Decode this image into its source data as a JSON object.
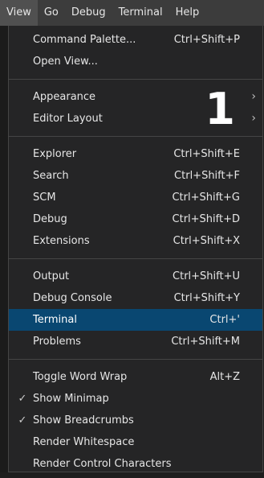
{
  "menubar": {
    "items": [
      {
        "label": "View"
      },
      {
        "label": "Go"
      },
      {
        "label": "Debug"
      },
      {
        "label": "Terminal"
      },
      {
        "label": "Help"
      }
    ]
  },
  "badge": "1",
  "menu": {
    "group1": [
      {
        "label": "Command Palette...",
        "shortcut": "Ctrl+Shift+P"
      },
      {
        "label": "Open View...",
        "shortcut": ""
      }
    ],
    "group2": [
      {
        "label": "Appearance",
        "submenu_icon": "chevron-right-icon"
      },
      {
        "label": "Editor Layout",
        "submenu_icon": "chevron-right-icon"
      }
    ],
    "group3": [
      {
        "label": "Explorer",
        "shortcut": "Ctrl+Shift+E"
      },
      {
        "label": "Search",
        "shortcut": "Ctrl+Shift+F"
      },
      {
        "label": "SCM",
        "shortcut": "Ctrl+Shift+G"
      },
      {
        "label": "Debug",
        "shortcut": "Ctrl+Shift+D"
      },
      {
        "label": "Extensions",
        "shortcut": "Ctrl+Shift+X"
      }
    ],
    "group4": [
      {
        "label": "Output",
        "shortcut": "Ctrl+Shift+U"
      },
      {
        "label": "Debug Console",
        "shortcut": "Ctrl+Shift+Y"
      },
      {
        "label": "Terminal",
        "shortcut": "Ctrl+'"
      },
      {
        "label": "Problems",
        "shortcut": "Ctrl+Shift+M"
      }
    ],
    "group5": [
      {
        "label": "Toggle Word Wrap",
        "shortcut": "Alt+Z"
      },
      {
        "label": "Show Minimap",
        "shortcut": "",
        "checked": true
      },
      {
        "label": "Show Breadcrumbs",
        "shortcut": "",
        "checked": true
      },
      {
        "label": "Render Whitespace",
        "shortcut": ""
      },
      {
        "label": "Render Control Characters",
        "shortcut": ""
      }
    ]
  },
  "colors": {
    "menubar_bg": "#3c3c3c",
    "menu_bg": "#252526",
    "selected_bg": "#094771"
  }
}
